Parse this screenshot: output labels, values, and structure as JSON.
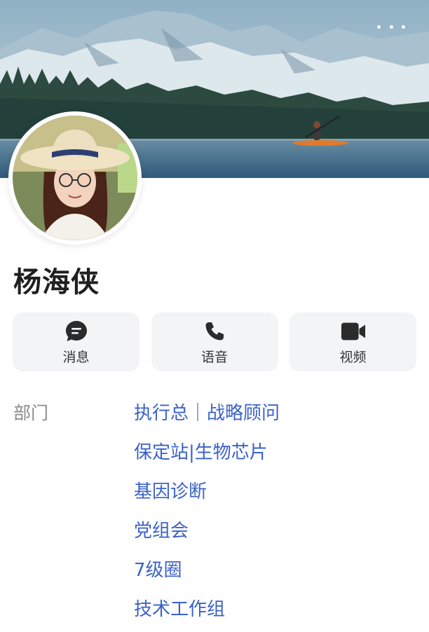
{
  "header": {
    "more_icon": "more-horizontal-icon"
  },
  "profile": {
    "name": "杨海侠"
  },
  "actions": [
    {
      "label": "消息",
      "icon": "chat-bubble-icon"
    },
    {
      "label": "语音",
      "icon": "phone-icon"
    },
    {
      "label": "视频",
      "icon": "video-camera-icon"
    }
  ],
  "info": {
    "department_label": "部门",
    "departments": [
      "执行总｜战略顾问",
      "保定站|生物芯片",
      "基因诊断",
      "党组会",
      "7级圈",
      "技术工作组"
    ]
  },
  "colors": {
    "link": "#3b62c9",
    "button_bg": "#f3f4f6",
    "label": "#8a8a8a",
    "name": "#1f1f1f"
  }
}
